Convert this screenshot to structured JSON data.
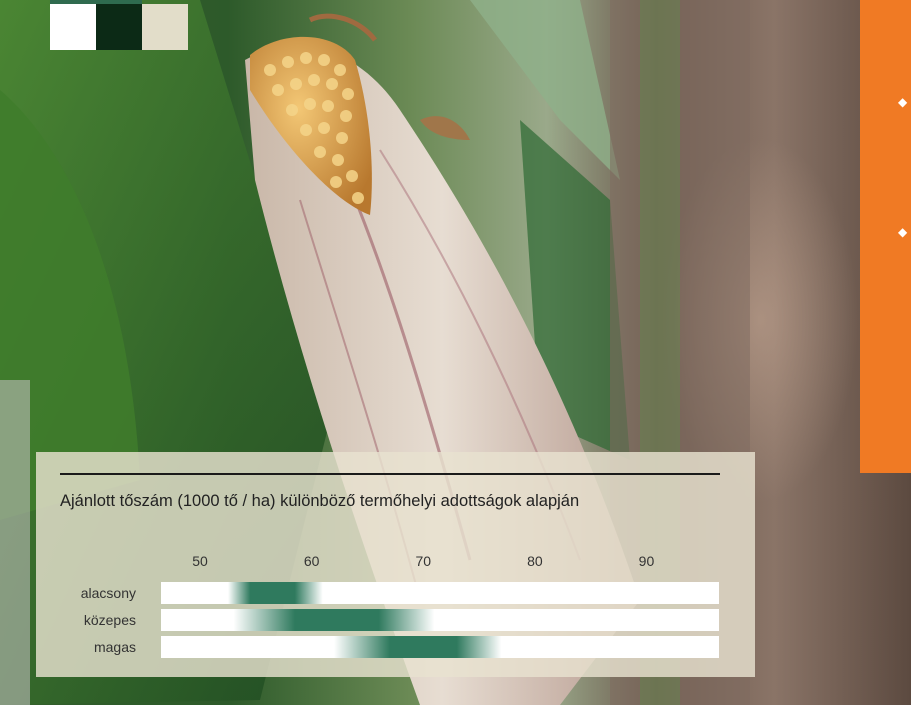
{
  "colors": {
    "orange_accent": "#f07a24",
    "panel_bg": "#e8e2d0",
    "bar_track": "#ffffff",
    "bar_peak": "#2f7a5e"
  },
  "swatches": [
    {
      "color": "#ffffff"
    },
    {
      "color": "#0c2a16"
    },
    {
      "color": "#e2ddc9"
    }
  ],
  "side_bullets": [
    "◆",
    "◆",
    "◆"
  ],
  "chart_data": {
    "type": "bar",
    "title": "Ajánlott tőszám (1000 tő / ha) különböző termőhelyi adottságok alapján",
    "xlabel": "",
    "ylabel": "",
    "x_ticks": [
      50,
      60,
      70,
      80,
      90
    ],
    "xlim": [
      46.5,
      96.5
    ],
    "categories": [
      "alacsony",
      "közepes",
      "magas"
    ],
    "ranges": [
      {
        "category": "alacsony",
        "start": 52.5,
        "peak_start": 54.5,
        "peak_end": 58.5,
        "end": 61.0
      },
      {
        "category": "közepes",
        "start": 53.0,
        "peak_start": 58.5,
        "peak_end": 66.0,
        "end": 71.0
      },
      {
        "category": "magas",
        "start": 62.0,
        "peak_start": 67.0,
        "peak_end": 73.0,
        "end": 77.0
      }
    ],
    "grid": false,
    "legend": "none"
  }
}
